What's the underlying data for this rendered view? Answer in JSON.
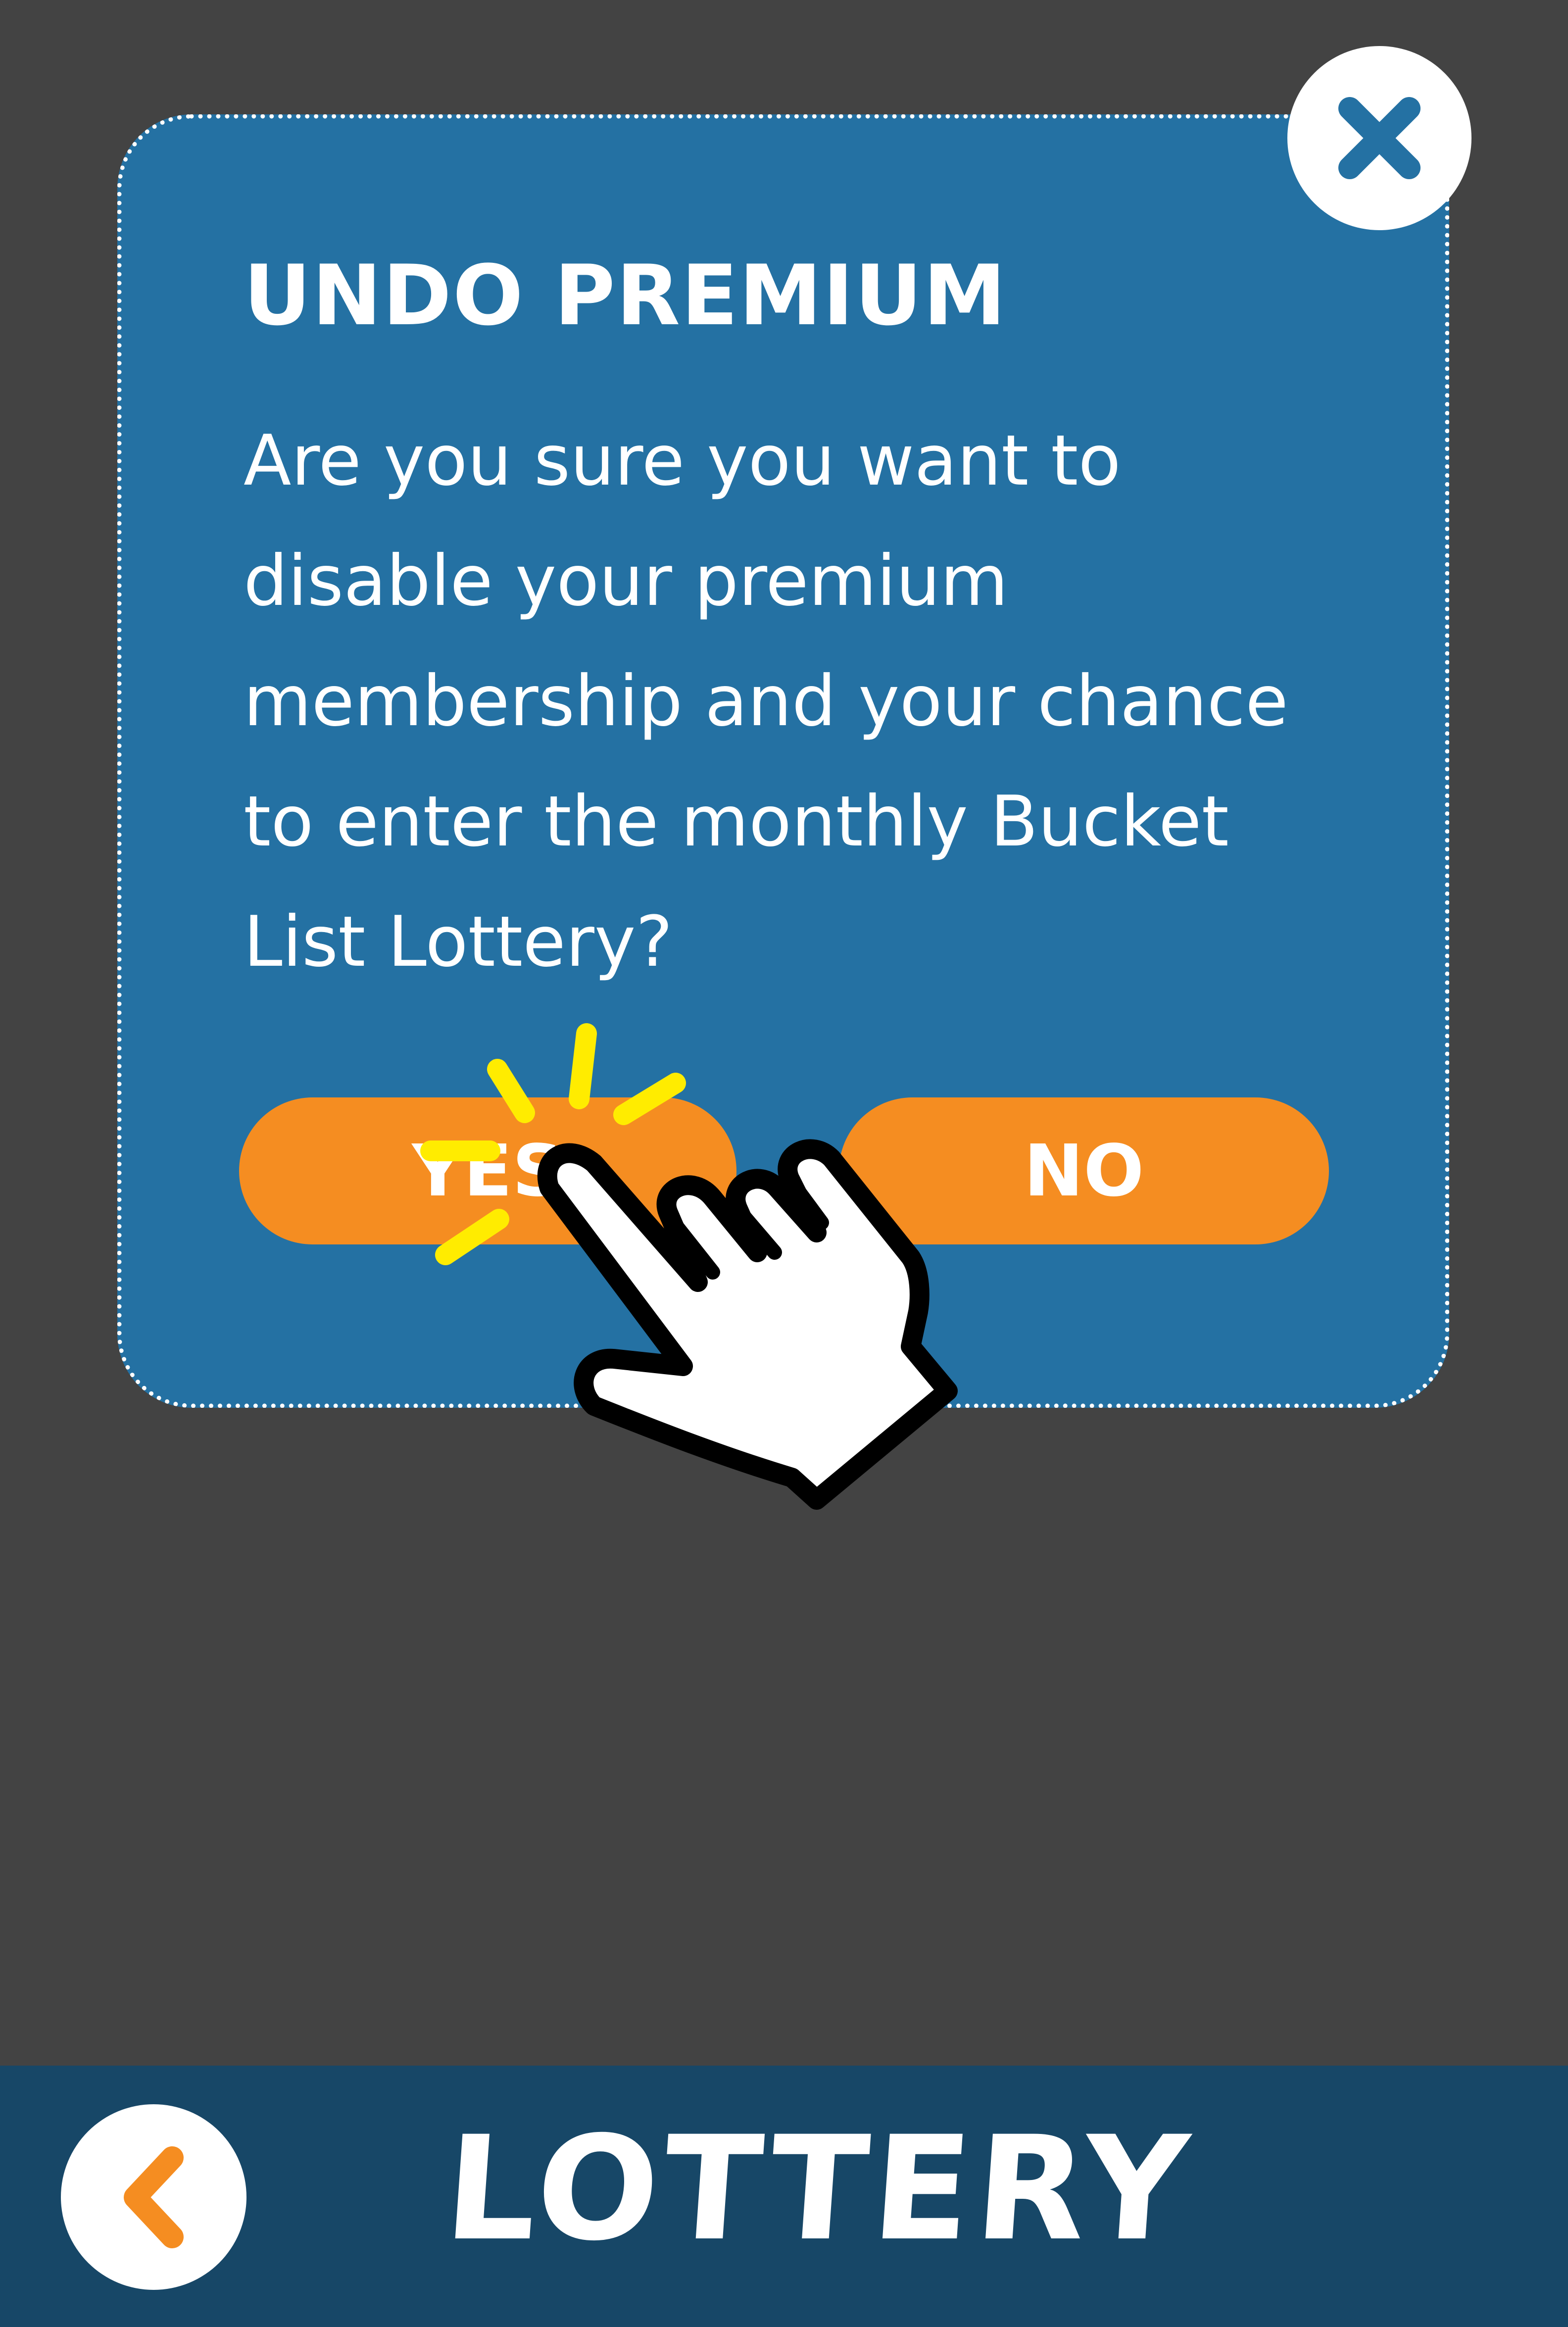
{
  "dialog": {
    "title": "UNDO PREMIUM",
    "message": "Are you sure you want to disable your premium membership and your chance to enter the monthly Bucket List Lottery?",
    "yes_label": "YES",
    "no_label": "NO",
    "close_icon": "close-icon"
  },
  "bottom_bar": {
    "title": "LOTTERY",
    "back_icon": "chevron-left-icon"
  },
  "overlay": {
    "pointer_icon": "hand-pointer-icon",
    "tap_effect": "tap-sparkle-icon"
  },
  "colors": {
    "background": "#434343",
    "dialog": "#2471a3",
    "button": "#f58d21",
    "bar": "#174767",
    "text": "#ffffff",
    "sparkle": "#ffec00"
  }
}
